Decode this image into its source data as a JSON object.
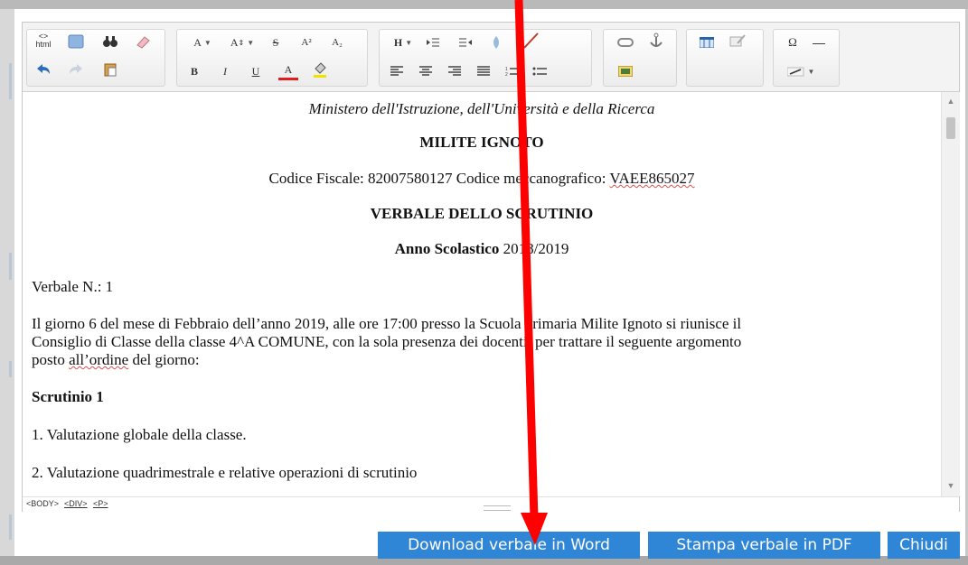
{
  "toolbar": {
    "html_label": "html",
    "html_symbol": "<>",
    "font_label": "A",
    "fontsize_label": "A",
    "strike_label": "S",
    "superscript_label": "A²",
    "subscript_label": "A₂",
    "heading_label": "H",
    "bold_label": "B",
    "italic_label": "I",
    "underline_label": "U",
    "fontcolor_label": "A",
    "omega_label": "Ω",
    "hr_label": "—"
  },
  "document": {
    "ministry": "Ministero dell'Istruzione, dell'Università e della Ricerca",
    "school_name": "MILITE IGNOTO",
    "codes_prefix": "Codice Fiscale: 82007580127 Codice meccanografico: ",
    "codes_mecc": "VAEE865027",
    "title": "VERBALE DELLO SCRUTINIO",
    "year_label": "Anno Scolastico",
    "year_value": " 2018/2019",
    "verbale_n": "Verbale N.: 1",
    "para_line1": "Il giorno 6 del mese di Febbraio dell’anno 2019, alle ore 17:00 presso la Scuola primaria  Milite Ignoto si riunisce il",
    "para_line2": "Consiglio di Classe della classe 4^A COMUNE, con la sola presenza dei docenti, per trattare il seguente argomento",
    "para_line3_a": "posto ",
    "para_line3_b": "all’ordine",
    "para_line3_c": " del giorno:",
    "scrutinio_heading": "Scrutinio 1",
    "item1": "1. Valutazione globale della classe.",
    "item2": "2. Valutazione quadrimestrale e relative operazioni di scrutinio"
  },
  "statusbar": {
    "body": "<BODY>",
    "div": "<DIV>",
    "p": "<P>"
  },
  "buttons": {
    "download_word": "Download verbale in Word",
    "print_pdf": "Stampa verbale in PDF",
    "close": "Chiudi"
  },
  "colors": {
    "button_bg": "#2f86d6",
    "annotation_arrow": "#ff0000"
  }
}
